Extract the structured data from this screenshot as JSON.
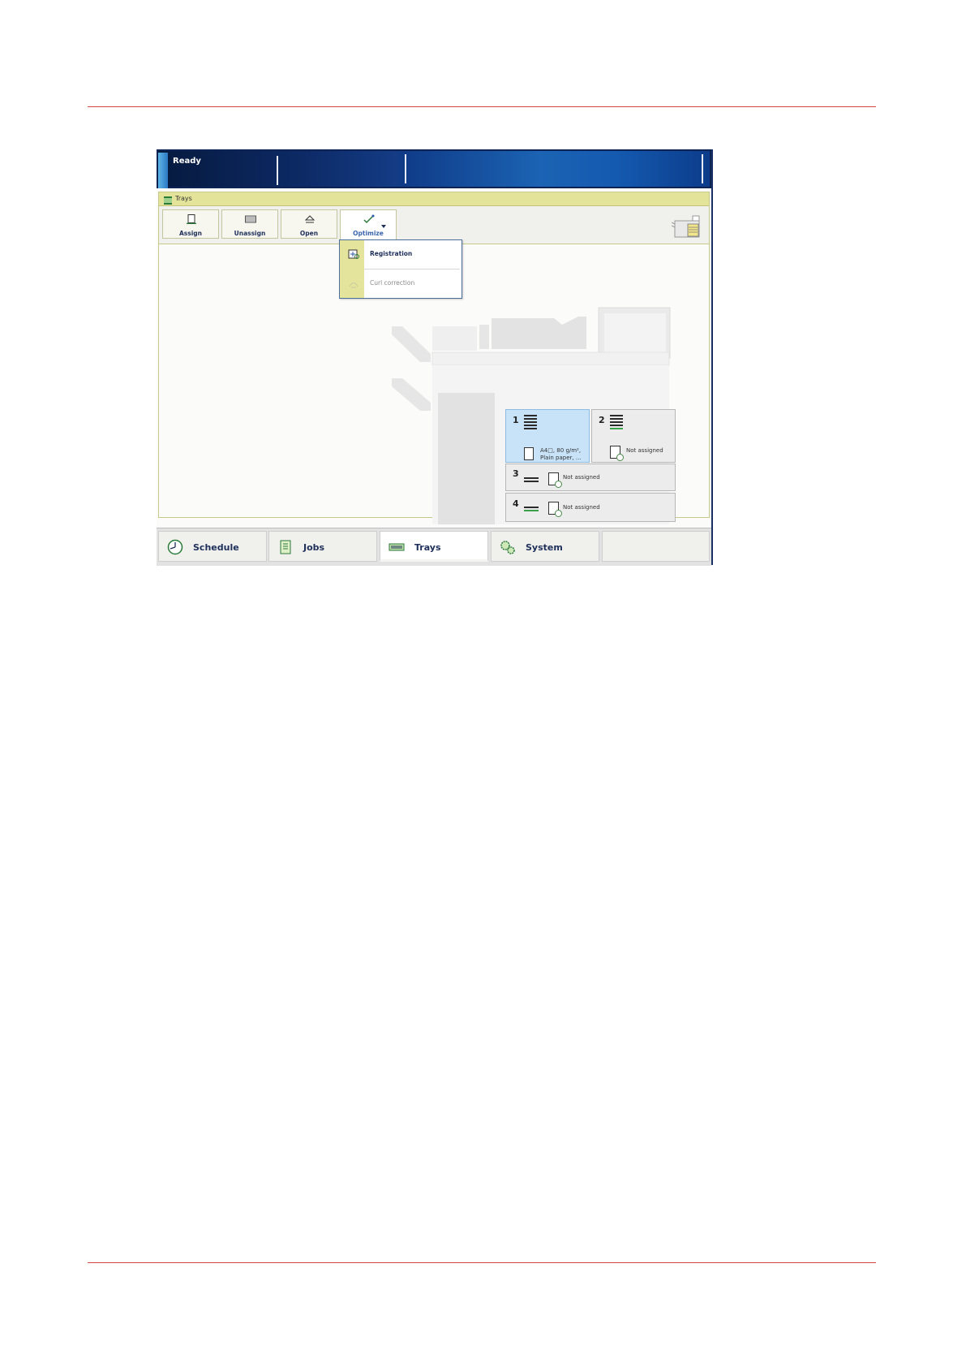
{
  "status": {
    "text": "Ready"
  },
  "panel": {
    "title": "Trays"
  },
  "toolbar": {
    "buttons": [
      {
        "label": "Assign",
        "icon": "assign-icon"
      },
      {
        "label": "Unassign",
        "icon": "unassign-icon"
      },
      {
        "label": "Open",
        "icon": "open-icon"
      },
      {
        "label": "Optimize",
        "icon": "optimize-icon"
      }
    ]
  },
  "optimize_menu": {
    "items": [
      {
        "label": "Registration",
        "enabled": true
      },
      {
        "label": "Curl correction",
        "enabled": false
      }
    ]
  },
  "trays": [
    {
      "number": "1",
      "line1": "A4□, 80 g/m²,",
      "line2": "Plain paper, ...",
      "selected": true
    },
    {
      "number": "2",
      "status": "Not assigned"
    },
    {
      "number": "3",
      "status": "Not assigned"
    },
    {
      "number": "4",
      "status": "Not assigned"
    }
  ],
  "nav": {
    "tabs": [
      {
        "label": "Schedule",
        "icon": "clock-icon"
      },
      {
        "label": "Jobs",
        "icon": "jobs-icon"
      },
      {
        "label": "Trays",
        "icon": "trays-icon",
        "active": true
      },
      {
        "label": "System",
        "icon": "gears-icon"
      }
    ]
  },
  "colors": {
    "accent_red": "#d9463f",
    "status_bar": "#0d2353",
    "panel_yellow": "#e3e39a",
    "selected_tray": "#c8e3f8"
  }
}
